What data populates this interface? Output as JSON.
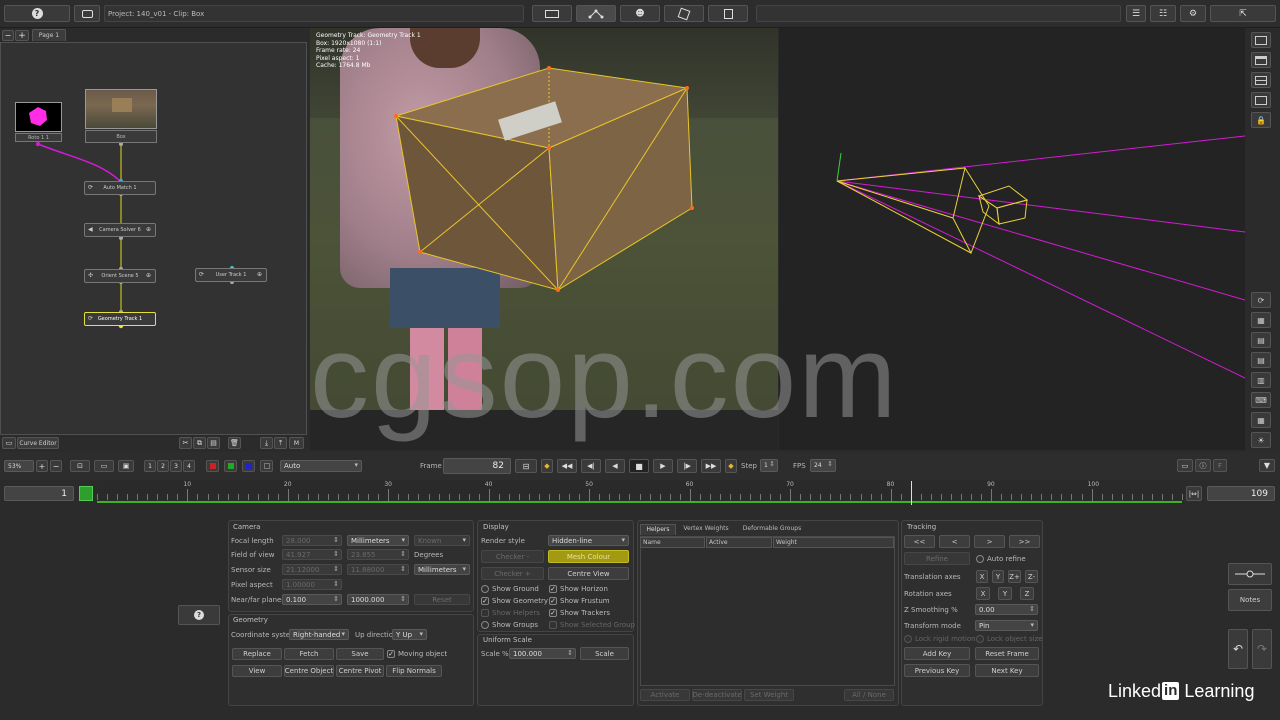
{
  "header": {
    "project_label": "Project: 140_v01 - Clip: Box",
    "help_icon": "question-icon",
    "camera_icon": "camera-icon"
  },
  "node_editor": {
    "page_tab": "Page 1",
    "nodes": [
      {
        "name": "roto",
        "label": "Roto 1 1"
      },
      {
        "name": "box",
        "label": "Box"
      },
      {
        "name": "auto-match",
        "label": "Auto Match 1"
      },
      {
        "name": "camera-solver",
        "label": "Camera Solver 6"
      },
      {
        "name": "orient-scene",
        "label": "Orient Scene 5"
      },
      {
        "name": "user-track",
        "label": "User Track 1"
      },
      {
        "name": "geometry-track",
        "label": "Geometry Track 1"
      }
    ],
    "curve_editor": "Curve Editor"
  },
  "viewer": {
    "info": [
      "Geometry Track: Geometry Track 1",
      "Box: 1920x1080 (1:1)",
      "Frame rate: 24",
      "Pixel aspect: 1",
      "Cache: 1764.8 Mb"
    ]
  },
  "playback": {
    "zoom": "53%",
    "layers": [
      "1",
      "2",
      "3",
      "4"
    ],
    "auto_select": "Auto",
    "frame_label": "Frame",
    "frame": "82",
    "step_label": "Step",
    "step": "1",
    "fps_label": "FPS",
    "fps": "24"
  },
  "timeline": {
    "start": "1",
    "end": "109",
    "ticks": [
      "10",
      "20",
      "30",
      "40",
      "50",
      "60",
      "70",
      "80",
      "90",
      "100"
    ],
    "current_frame": 82,
    "range": [
      1,
      109
    ]
  },
  "camera": {
    "title": "Camera",
    "focal_length_label": "Focal length",
    "focal_length": "28.000",
    "focal_units": "Millimeters",
    "focal_known": "Known",
    "fov_label": "Field of view",
    "fov_h": "41.927",
    "fov_v": "23.855",
    "fov_units": "Degrees",
    "sensor_label": "Sensor size",
    "sensor_w": "21.12000",
    "sensor_h": "11.88000",
    "sensor_units": "Millimeters",
    "pixel_aspect_label": "Pixel aspect",
    "pixel_aspect": "1.00000",
    "nearfar_label": "Near/far planes",
    "near": "0.100",
    "far": "1000.000",
    "reset": "Reset"
  },
  "geometry": {
    "title": "Geometry",
    "coord_label": "Coordinate system",
    "coord_value": "Right-handed",
    "up_label": "Up direction",
    "up_value": "Y Up",
    "replace": "Replace",
    "fetch": "Fetch",
    "save": "Save",
    "moving_object": "Moving object",
    "view": "View",
    "centre_object": "Centre Object",
    "centre_pivot": "Centre Pivot",
    "flip_normals": "Flip Normals"
  },
  "display": {
    "title": "Display",
    "render_style_label": "Render style",
    "render_style": "Hidden-line",
    "checker_minus": "Checker -",
    "mesh_colour": "Mesh Colour",
    "checker_plus": "Checker +",
    "centre_view": "Centre View",
    "show_ground": "Show Ground",
    "show_horizon": "Show Horizon",
    "show_geometry": "Show Geometry",
    "show_frustum": "Show Frustum",
    "show_helpers": "Show Helpers",
    "show_trackers": "Show Trackers",
    "show_groups": "Show Groups",
    "show_selected_group": "Show Selected Group",
    "uniform_scale_title": "Uniform Scale",
    "scale_label": "Scale %",
    "scale_value": "100.000",
    "scale_btn": "Scale"
  },
  "helpers": {
    "tabs": [
      "Helpers",
      "Vertex Weights",
      "Deformable Groups"
    ],
    "columns": [
      "Name",
      "Active",
      "Weight"
    ],
    "activate": "Activate",
    "deactivate": "De-deactivate",
    "set_weight": "Set Weight",
    "all_none": "All / None"
  },
  "tracking": {
    "title": "Tracking",
    "nav": [
      "<<",
      "<",
      ">",
      ">>"
    ],
    "refine": "Refine",
    "auto_refine": "Auto refine",
    "translation_axes_label": "Translation axes",
    "translation_axes": [
      "X",
      "Y",
      "Z+",
      "Z-"
    ],
    "rotation_axes_label": "Rotation axes",
    "rotation_axes": [
      "X",
      "Y",
      "Z"
    ],
    "z_smoothing_label": "Z Smoothing %",
    "z_smoothing": "0.00",
    "transform_mode_label": "Transform mode",
    "transform_mode": "Pin",
    "lock_rigid": "Lock rigid motion",
    "lock_size": "Lock object size",
    "add_key": "Add Key",
    "reset_frame": "Reset Frame",
    "previous_key": "Previous Key",
    "next_key": "Next Key"
  },
  "right_side": {
    "notes": "Notes"
  },
  "watermark": "cgsop.com",
  "branding": {
    "linkedin": "Linked",
    "in": "in",
    "learning": "Learning"
  },
  "colors": {
    "accent_yellow": "#e8d23a",
    "magenta": "#d21cd2",
    "green": "#3fb21f",
    "node_selected": "#e6e13a"
  }
}
